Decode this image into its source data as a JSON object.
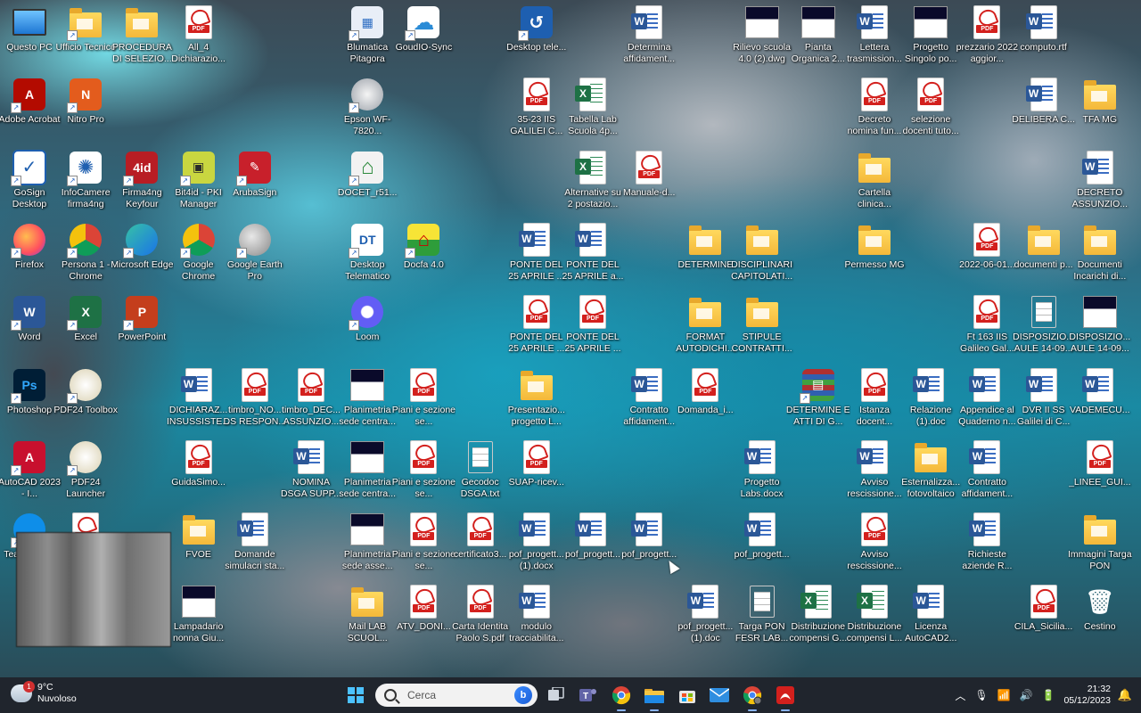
{
  "desktop": {
    "icons": [
      {
        "label": "Questo PC",
        "type": "pc",
        "x": 0,
        "y": 0
      },
      {
        "label": "Ufficio Tecnico",
        "type": "app-folder-person",
        "x": 1,
        "y": 0
      },
      {
        "label": "PROCEDURA DI SELEZIO...",
        "type": "folder",
        "x": 2,
        "y": 0
      },
      {
        "label": "All_4 Dichiarazio...",
        "type": "pdf",
        "x": 3,
        "y": 0
      },
      {
        "label": "Blumatica Pitagora",
        "type": "app-blumatica",
        "x": 6,
        "y": 0
      },
      {
        "label": "GoudIO-Sync",
        "type": "app-cloud",
        "x": 7,
        "y": 0
      },
      {
        "label": "Desktop tele...",
        "type": "app-desktop-tele",
        "x": 9,
        "y": 0
      },
      {
        "label": "Determina affidament...",
        "type": "doc",
        "x": 11,
        "y": 0
      },
      {
        "label": "Rilievo scuola 4.0 (2).dwg",
        "type": "img",
        "x": 13,
        "y": 0
      },
      {
        "label": "Pianta Organica 2...",
        "type": "img",
        "x": 14,
        "y": 0
      },
      {
        "label": "Lettera trasmission...",
        "type": "doc",
        "x": 15,
        "y": 0
      },
      {
        "label": "Progetto Singolo po...",
        "type": "img",
        "x": 16,
        "y": 0
      },
      {
        "label": "prezzario 2022 aggior...",
        "type": "pdf",
        "x": 17,
        "y": 0
      },
      {
        "label": "computo.rtf",
        "type": "doc",
        "x": 18,
        "y": 0
      },
      {
        "label": "Adobe Acrobat",
        "type": "app-acrobat",
        "x": 0,
        "y": 1
      },
      {
        "label": "Nitro Pro",
        "type": "app-nitro",
        "x": 1,
        "y": 1
      },
      {
        "label": "Epson WF-7820...",
        "type": "app-epson",
        "x": 6,
        "y": 1
      },
      {
        "label": "35-23 IIS GALILEI C...",
        "type": "pdf",
        "x": 9,
        "y": 1
      },
      {
        "label": "Tabella Lab Scuola 4p...",
        "type": "xls",
        "x": 10,
        "y": 1
      },
      {
        "label": "Decreto nomina fun...",
        "type": "pdf",
        "x": 15,
        "y": 1
      },
      {
        "label": "selezione docenti tuto...",
        "type": "pdf",
        "x": 16,
        "y": 1
      },
      {
        "label": "DELIBERA C...",
        "type": "doc",
        "x": 18,
        "y": 1
      },
      {
        "label": "TFA MG",
        "type": "folder",
        "x": 19,
        "y": 1
      },
      {
        "label": "GoSign Desktop",
        "type": "app-gosign",
        "x": 0,
        "y": 2
      },
      {
        "label": "InfoCamere firma4ng",
        "type": "app-infocamere",
        "x": 1,
        "y": 2
      },
      {
        "label": "Firma4ng Keyfour",
        "type": "app-firma4ng",
        "x": 2,
        "y": 2
      },
      {
        "label": "Bit4id - PKI Manager",
        "type": "app-bit4id",
        "x": 3,
        "y": 2
      },
      {
        "label": "ArubaSign",
        "type": "app-aruba",
        "x": 4,
        "y": 2
      },
      {
        "label": "DOCET_r51...",
        "type": "app-docet",
        "x": 6,
        "y": 2
      },
      {
        "label": "Alternative su 2 postazio...",
        "type": "xls",
        "x": 10,
        "y": 2
      },
      {
        "label": "Manuale-d...",
        "type": "pdf",
        "x": 11,
        "y": 2
      },
      {
        "label": "Cartella clinica...",
        "type": "folder",
        "x": 15,
        "y": 2
      },
      {
        "label": "DECRETO ASSUNZIO...",
        "type": "doc",
        "x": 19,
        "y": 2
      },
      {
        "label": "Firefox",
        "type": "app-firefox",
        "x": 0,
        "y": 3
      },
      {
        "label": "Persona 1 - Chrome",
        "type": "app-chrome-person",
        "x": 1,
        "y": 3
      },
      {
        "label": "Microsoft Edge",
        "type": "app-edge",
        "x": 2,
        "y": 3
      },
      {
        "label": "Google Chrome",
        "type": "app-chrome",
        "x": 3,
        "y": 3
      },
      {
        "label": "Google Earth Pro",
        "type": "app-earth",
        "x": 4,
        "y": 3
      },
      {
        "label": "Desktop Telematico",
        "type": "app-dt",
        "x": 6,
        "y": 3
      },
      {
        "label": "Docfa 4.0",
        "type": "app-docfa",
        "x": 7,
        "y": 3
      },
      {
        "label": "PONTE DEL 25 APRILE ...",
        "type": "doc",
        "x": 9,
        "y": 3
      },
      {
        "label": "PONTE DEL 25 APRILE a...",
        "type": "doc",
        "x": 10,
        "y": 3
      },
      {
        "label": "DETERMINE",
        "type": "folder",
        "x": 12,
        "y": 3
      },
      {
        "label": "DISCIPLINARI CAPITOLATI...",
        "type": "folder",
        "x": 13,
        "y": 3
      },
      {
        "label": "Permesso MG",
        "type": "folder",
        "x": 15,
        "y": 3
      },
      {
        "label": "2022-06-01...",
        "type": "pdf",
        "x": 17,
        "y": 3
      },
      {
        "label": "documenti p...",
        "type": "folder",
        "x": 18,
        "y": 3
      },
      {
        "label": "Documenti Incarichi di...",
        "type": "folder",
        "x": 19,
        "y": 3
      },
      {
        "label": "Word",
        "type": "app-word",
        "x": 0,
        "y": 4
      },
      {
        "label": "Excel",
        "type": "app-excel",
        "x": 1,
        "y": 4
      },
      {
        "label": "PowerPoint",
        "type": "app-ppt",
        "x": 2,
        "y": 4
      },
      {
        "label": "Loom",
        "type": "app-loom",
        "x": 6,
        "y": 4
      },
      {
        "label": "PONTE DEL 25 APRILE ...",
        "type": "pdf",
        "x": 9,
        "y": 4
      },
      {
        "label": "PONTE DEL 25 APRILE ...",
        "type": "pdf",
        "x": 10,
        "y": 4
      },
      {
        "label": "FORMAT AUTODICHI...",
        "type": "folder",
        "x": 12,
        "y": 4
      },
      {
        "label": "STIPULE CONTRATTI...",
        "type": "folder",
        "x": 13,
        "y": 4
      },
      {
        "label": "Ft 163 IIS Galileo Gal...",
        "type": "pdf",
        "x": 17,
        "y": 4
      },
      {
        "label": "DISPOSIZIO... AULE 14-09...",
        "type": "txt",
        "x": 18,
        "y": 4
      },
      {
        "label": "DISPOSIZIO... AULE 14-09...",
        "type": "img",
        "x": 19,
        "y": 4
      },
      {
        "label": "Photoshop",
        "type": "app-ps",
        "x": 0,
        "y": 5
      },
      {
        "label": "PDF24 Toolbox",
        "type": "app-pdf24",
        "x": 1,
        "y": 5
      },
      {
        "label": "DICHIARAZ... INSUSSISTE...",
        "type": "doc",
        "x": 3,
        "y": 5
      },
      {
        "label": "timbro_NO... DS RESPON...",
        "type": "pdf",
        "x": 4,
        "y": 5
      },
      {
        "label": "timbro_DEC... ASSUNZIO...",
        "type": "pdf",
        "x": 5,
        "y": 5
      },
      {
        "label": "Planimetria sede centra...",
        "type": "img",
        "x": 6,
        "y": 5
      },
      {
        "label": "Piani e sezione se...",
        "type": "pdf",
        "x": 7,
        "y": 5
      },
      {
        "label": "Presentazio... progetto L...",
        "type": "folder",
        "x": 9,
        "y": 5
      },
      {
        "label": "Contratto affidament...",
        "type": "doc",
        "x": 11,
        "y": 5
      },
      {
        "label": "Domanda_i...",
        "type": "pdf",
        "x": 12,
        "y": 5
      },
      {
        "label": "DETERMINE E ATTI DI G...",
        "type": "app-winrar",
        "x": 14,
        "y": 5
      },
      {
        "label": "Istanza docent...",
        "type": "pdf",
        "x": 15,
        "y": 5
      },
      {
        "label": "Relazione (1).doc",
        "type": "doc",
        "x": 16,
        "y": 5
      },
      {
        "label": "Appendice al Quaderno n...",
        "type": "doc",
        "x": 17,
        "y": 5
      },
      {
        "label": "DVR II SS Galilei di C...",
        "type": "doc",
        "x": 18,
        "y": 5
      },
      {
        "label": "VADEMECU...",
        "type": "doc",
        "x": 19,
        "y": 5
      },
      {
        "label": "AutoCAD 2023 - I...",
        "type": "app-autocad",
        "x": 0,
        "y": 6
      },
      {
        "label": "PDF24 Launcher",
        "type": "app-pdf24",
        "x": 1,
        "y": 6
      },
      {
        "label": "GuidaSimo...",
        "type": "pdf",
        "x": 3,
        "y": 6
      },
      {
        "label": "NOMINA DSGA SUPP...",
        "type": "doc",
        "x": 5,
        "y": 6
      },
      {
        "label": "Planimetria sede centra...",
        "type": "img",
        "x": 6,
        "y": 6
      },
      {
        "label": "Piani e sezione se...",
        "type": "pdf",
        "x": 7,
        "y": 6
      },
      {
        "label": "Gecodoc DSGA.txt",
        "type": "txt",
        "x": 8,
        "y": 6
      },
      {
        "label": "SUAP-ricev...",
        "type": "pdf",
        "x": 9,
        "y": 6
      },
      {
        "label": "Progetto Labs.docx",
        "type": "doc",
        "x": 13,
        "y": 6
      },
      {
        "label": "Avviso rescissione...",
        "type": "doc",
        "x": 15,
        "y": 6
      },
      {
        "label": "Esternalizza... fotovoltaico",
        "type": "folder",
        "x": 16,
        "y": 6
      },
      {
        "label": "Contratto affidament...",
        "type": "doc",
        "x": 17,
        "y": 6
      },
      {
        "label": "_LINEE_GUI...",
        "type": "pdf",
        "x": 19,
        "y": 6
      },
      {
        "label": "TeamViewer",
        "type": "app-teamviewer",
        "x": 0,
        "y": 7
      },
      {
        "label": "",
        "type": "pdf",
        "x": 1,
        "y": 7
      },
      {
        "label": "FVOE",
        "type": "folder",
        "x": 3,
        "y": 7
      },
      {
        "label": "Domande simulacri sta...",
        "type": "doc",
        "x": 4,
        "y": 7
      },
      {
        "label": "Planimetria sede asse...",
        "type": "img",
        "x": 6,
        "y": 7
      },
      {
        "label": "Piani e sezione se...",
        "type": "pdf",
        "x": 7,
        "y": 7
      },
      {
        "label": "certificato3...",
        "type": "pdf",
        "x": 8,
        "y": 7
      },
      {
        "label": "pof_progett... (1).docx",
        "type": "doc",
        "x": 9,
        "y": 7
      },
      {
        "label": "pof_progett...",
        "type": "doc",
        "x": 10,
        "y": 7
      },
      {
        "label": "pof_progett...",
        "type": "doc",
        "x": 11,
        "y": 7
      },
      {
        "label": "pof_progett...",
        "type": "doc",
        "x": 13,
        "y": 7
      },
      {
        "label": "Avviso rescissione...",
        "type": "pdf",
        "x": 15,
        "y": 7
      },
      {
        "label": "Richieste aziende R...",
        "type": "doc",
        "x": 17,
        "y": 7
      },
      {
        "label": "Immagini Targa PON",
        "type": "folder",
        "x": 19,
        "y": 7
      },
      {
        "label": "Lampadario nonna Giu...",
        "type": "img",
        "x": 3,
        "y": 8
      },
      {
        "label": "Mail LAB SCUOL...",
        "type": "folder",
        "x": 6,
        "y": 8
      },
      {
        "label": "ATV_DONI...",
        "type": "pdf",
        "x": 7,
        "y": 8
      },
      {
        "label": "Carta Identita Paolo S.pdf",
        "type": "pdf",
        "x": 8,
        "y": 8
      },
      {
        "label": "modulo tracciabilita...",
        "type": "doc",
        "x": 9,
        "y": 8
      },
      {
        "label": "pof_progett... (1).doc",
        "type": "doc",
        "x": 12,
        "y": 8
      },
      {
        "label": "Targa PON FESR LAB...",
        "type": "txt",
        "x": 13,
        "y": 8
      },
      {
        "label": "Distribuzione compensi G...",
        "type": "xls",
        "x": 14,
        "y": 8
      },
      {
        "label": "Distribuzione compensi L...",
        "type": "xls",
        "x": 15,
        "y": 8
      },
      {
        "label": "Licenza AutoCAD2...",
        "type": "doc",
        "x": 16,
        "y": 8
      },
      {
        "label": "CILA_Sicilia...",
        "type": "pdf",
        "x": 18,
        "y": 8
      },
      {
        "label": "Cestino",
        "type": "app-recycle",
        "x": 19,
        "y": 8
      }
    ]
  },
  "colors": {
    "pdf_red": "#d3201d",
    "word_blue": "#2b5797",
    "excel_green": "#1e7145",
    "folder_yellow": "#f4b83a",
    "taskbar_bg": "#20252d"
  },
  "taskbar": {
    "weather": {
      "temp": "9°C",
      "condition": "Nuvoloso",
      "badge": "1"
    },
    "search_placeholder": "Cerca",
    "pinned": [
      {
        "name": "start-button",
        "icon": "windows-icon"
      },
      {
        "name": "task-view-button",
        "icon": "task-view-icon"
      },
      {
        "name": "teams-button",
        "icon": "teams-icon"
      },
      {
        "name": "chrome-taskbar-button",
        "icon": "chrome-icon"
      },
      {
        "name": "file-explorer-button",
        "icon": "folder-icon"
      },
      {
        "name": "store-button",
        "icon": "store-icon"
      },
      {
        "name": "mail-button",
        "icon": "mail-icon"
      },
      {
        "name": "chrome-profile-button",
        "icon": "chrome-icon"
      },
      {
        "name": "acrobat-taskbar-button",
        "icon": "acrobat-icon"
      }
    ],
    "clock": {
      "time": "21:32",
      "date": "05/12/2023"
    }
  }
}
